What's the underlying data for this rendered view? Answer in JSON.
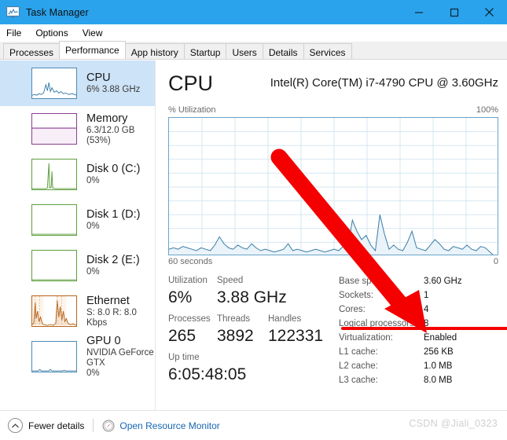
{
  "window": {
    "title": "Task Manager",
    "icon": "task-manager-icon",
    "minimize_label": "–",
    "maximize_label": "□",
    "close_label": "✕",
    "titlebar_color": "#2aa3ec"
  },
  "menu": {
    "items": [
      {
        "label": "File"
      },
      {
        "label": "Options"
      },
      {
        "label": "View"
      }
    ]
  },
  "tabs": {
    "active": "Performance",
    "items": [
      {
        "label": "Processes"
      },
      {
        "label": "Performance"
      },
      {
        "label": "App history"
      },
      {
        "label": "Startup"
      },
      {
        "label": "Users"
      },
      {
        "label": "Details"
      },
      {
        "label": "Services"
      }
    ]
  },
  "sidebar": {
    "items": [
      {
        "name": "cpu",
        "title": "CPU",
        "sub": "6%  3.88 GHz",
        "sub2": "",
        "selected": true,
        "accent": "#4e8ab5"
      },
      {
        "name": "memory",
        "title": "Memory",
        "sub": "6.3/12.0 GB (53%)",
        "sub2": "",
        "selected": false,
        "accent": "#8a3f90"
      },
      {
        "name": "disk0",
        "title": "Disk 0 (C:)",
        "sub": "0%",
        "sub2": "",
        "selected": false,
        "accent": "#5e9e3e"
      },
      {
        "name": "disk1",
        "title": "Disk 1 (D:)",
        "sub": "0%",
        "sub2": "",
        "selected": false,
        "accent": "#5e9e3e"
      },
      {
        "name": "disk2",
        "title": "Disk 2 (E:)",
        "sub": "0%",
        "sub2": "",
        "selected": false,
        "accent": "#5e9e3e"
      },
      {
        "name": "ethernet",
        "title": "Ethernet",
        "sub": "S: 8.0 R: 8.0 Kbps",
        "sub2": "",
        "selected": false,
        "accent": "#b5651d"
      },
      {
        "name": "gpu0",
        "title": "GPU 0",
        "sub": "NVIDIA GeForce GTX",
        "sub2": "0%",
        "selected": false,
        "accent": "#4e8ab5"
      }
    ]
  },
  "main": {
    "heading": "CPU",
    "model": "Intel(R) Core(TM) i7-4790 CPU @ 3.60GHz",
    "y_axis_label": "% Utilization",
    "y_axis_max": "100%",
    "x_axis_left": "60 seconds",
    "x_axis_right": "0",
    "stats_left": [
      [
        {
          "label": "Utilization",
          "value": "6%"
        },
        {
          "label": "Speed",
          "value": "3.88 GHz"
        }
      ],
      [
        {
          "label": "Processes",
          "value": "265"
        },
        {
          "label": "Threads",
          "value": "3892"
        },
        {
          "label": "Handles",
          "value": "122331"
        }
      ],
      [
        {
          "label": "Up time",
          "value": "6:05:48:05"
        }
      ]
    ],
    "stats_right": [
      {
        "label": "Base speed:",
        "value": "3.60 GHz"
      },
      {
        "label": "Sockets:",
        "value": "1"
      },
      {
        "label": "Cores:",
        "value": "4"
      },
      {
        "label": "Logical processors:",
        "value": "8"
      },
      {
        "label": "Virtualization:",
        "value": "Enabled"
      },
      {
        "label": "L1 cache:",
        "value": "256 KB"
      },
      {
        "label": "L2 cache:",
        "value": "1.0 MB"
      },
      {
        "label": "L3 cache:",
        "value": "8.0 MB"
      }
    ]
  },
  "status": {
    "fewer_details": "Fewer details",
    "resource_monitor": "Open Resource Monitor",
    "chevron_icon": "chevron-up-icon",
    "resource_monitor_icon": "resource-monitor-icon"
  },
  "annotation": {
    "arrow_color": "#f40000",
    "underline_color": "#f40000",
    "target_row": "Logical processors:"
  },
  "watermark": {
    "text": "CSDN @Jiali_0323"
  },
  "chart_data": {
    "type": "area",
    "title": "% Utilization",
    "ylabel": "% Utilization",
    "xlabel": "60 seconds",
    "ylim": [
      0,
      100
    ],
    "xlim": [
      60,
      0
    ],
    "grid": true,
    "grid_cols": 10,
    "grid_rows": 10,
    "line_color": "#3a7ea8",
    "fill_color": "#e8f2f8",
    "current_value": 6,
    "series": [
      {
        "name": "CPU Utilization",
        "values": [
          5,
          6,
          5,
          7,
          6,
          5,
          4,
          6,
          5,
          4,
          8,
          14,
          9,
          7,
          6,
          5,
          7,
          6,
          5,
          9,
          7,
          5,
          6,
          5,
          4,
          5,
          6,
          9,
          5,
          6,
          5,
          4,
          5,
          6,
          5,
          4,
          5,
          6,
          5,
          7,
          6,
          26,
          18,
          12,
          15,
          8,
          5,
          30,
          16,
          6,
          8,
          6,
          5,
          10,
          18,
          7,
          6,
          5,
          8,
          12,
          9,
          6,
          5,
          7,
          6,
          5,
          8,
          6,
          5,
          7,
          6,
          4
        ]
      }
    ]
  }
}
